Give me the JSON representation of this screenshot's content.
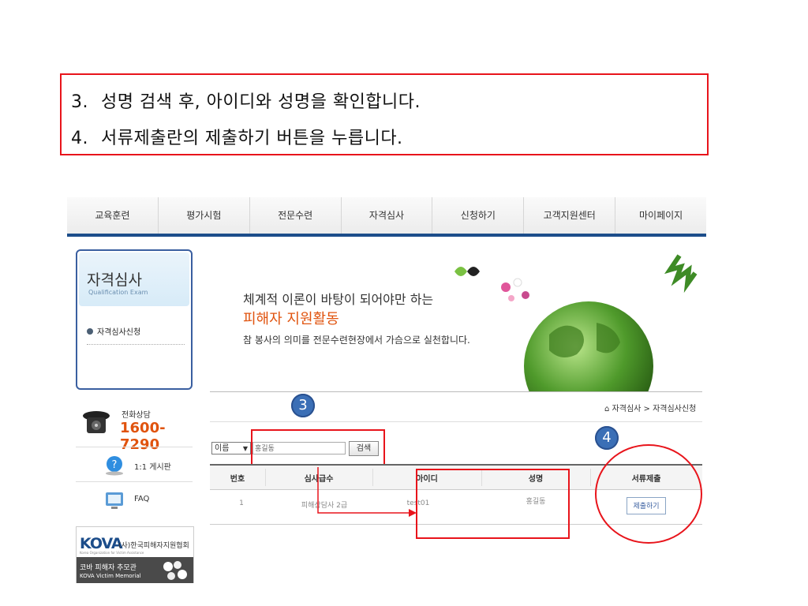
{
  "instructions": {
    "line1_num": "3.",
    "line1_text": "성명 검색 후, 아이디와 성명을 확인합니다.",
    "line2_num": "4.",
    "line2_text": "서류제출란의 제출하기 버튼을 누릅니다."
  },
  "nav": {
    "items": [
      "교육훈련",
      "평가시험",
      "전문수련",
      "자격심사",
      "신청하기",
      "고객지원센터",
      "마이페이지"
    ]
  },
  "sidebar": {
    "title": "자격심사",
    "subtitle": "Qualification Exam",
    "menu_item": "자격심사신청",
    "phone_label": "전화상담",
    "phone_number": "1600-7290",
    "board_label": "1:1 게시판",
    "faq_label": "FAQ",
    "kova_logo": "KOVA",
    "kova_name": "(사)한국피해자지원협회",
    "kova_tagline": "Korea Organization for Victim Assistance",
    "memorial_ko": "코바 피해자 추모관",
    "memorial_en": "KOVA Victim Memorial"
  },
  "banner": {
    "line1": "체계적 이론이 바탕이 되어야만 하는",
    "line2": "피해자 지원활동",
    "line3": "참 봉사의 의미를 전문수련현장에서 가슴으로 실천합니다."
  },
  "breadcrumb": "자격심사 > 자격심사신청",
  "markers": {
    "step3": "3",
    "step4": "4"
  },
  "search": {
    "field_select": "이름",
    "query": "홍길동",
    "button": "검색"
  },
  "table": {
    "headers": [
      "번호",
      "심사급수",
      "아이디",
      "성명",
      "서류제출"
    ],
    "rows": [
      {
        "no": "1",
        "grade": "피해상담사 2급",
        "id": "test01",
        "name": "홍길동",
        "action": "제출하기"
      }
    ]
  },
  "colors": {
    "highlight": "#e8141b",
    "accent": "#e0530e",
    "navy": "#1c4d8a",
    "marker": "#3b6fb6"
  }
}
